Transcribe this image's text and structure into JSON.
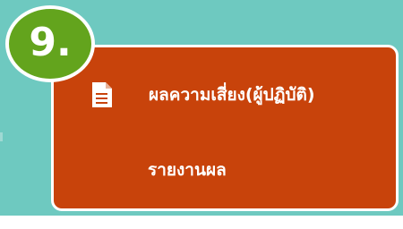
{
  "step": {
    "badge": "9."
  },
  "card": {
    "items": [
      {
        "label": "ผลความเสี่ยง(ผู้ปฏิบัติ)",
        "icon": "document-icon"
      },
      {
        "label": "รายงานผล"
      }
    ]
  },
  "colors": {
    "background": "#6ec9c0",
    "card": "#c8430b",
    "badge": "#63a41d",
    "text": "#ffffff"
  }
}
